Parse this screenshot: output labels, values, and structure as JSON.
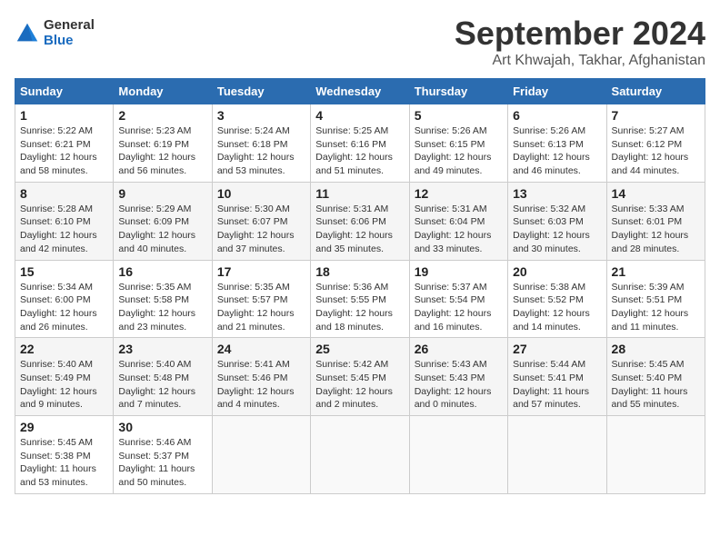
{
  "logo": {
    "general": "General",
    "blue": "Blue"
  },
  "header": {
    "month_title": "September 2024",
    "subtitle": "Art Khwajah, Takhar, Afghanistan"
  },
  "weekdays": [
    "Sunday",
    "Monday",
    "Tuesday",
    "Wednesday",
    "Thursday",
    "Friday",
    "Saturday"
  ],
  "weeks": [
    [
      {
        "day": "1",
        "sunrise": "5:22 AM",
        "sunset": "6:21 PM",
        "hours": "12",
        "minutes": "58"
      },
      {
        "day": "2",
        "sunrise": "5:23 AM",
        "sunset": "6:19 PM",
        "hours": "12",
        "minutes": "56"
      },
      {
        "day": "3",
        "sunrise": "5:24 AM",
        "sunset": "6:18 PM",
        "hours": "12",
        "minutes": "53"
      },
      {
        "day": "4",
        "sunrise": "5:25 AM",
        "sunset": "6:16 PM",
        "hours": "12",
        "minutes": "51"
      },
      {
        "day": "5",
        "sunrise": "5:26 AM",
        "sunset": "6:15 PM",
        "hours": "12",
        "minutes": "49"
      },
      {
        "day": "6",
        "sunrise": "5:26 AM",
        "sunset": "6:13 PM",
        "hours": "12",
        "minutes": "46"
      },
      {
        "day": "7",
        "sunrise": "5:27 AM",
        "sunset": "6:12 PM",
        "hours": "12",
        "minutes": "44"
      }
    ],
    [
      {
        "day": "8",
        "sunrise": "5:28 AM",
        "sunset": "6:10 PM",
        "hours": "12",
        "minutes": "42"
      },
      {
        "day": "9",
        "sunrise": "5:29 AM",
        "sunset": "6:09 PM",
        "hours": "12",
        "minutes": "40"
      },
      {
        "day": "10",
        "sunrise": "5:30 AM",
        "sunset": "6:07 PM",
        "hours": "12",
        "minutes": "37"
      },
      {
        "day": "11",
        "sunrise": "5:31 AM",
        "sunset": "6:06 PM",
        "hours": "12",
        "minutes": "35"
      },
      {
        "day": "12",
        "sunrise": "5:31 AM",
        "sunset": "6:04 PM",
        "hours": "12",
        "minutes": "33"
      },
      {
        "day": "13",
        "sunrise": "5:32 AM",
        "sunset": "6:03 PM",
        "hours": "12",
        "minutes": "30"
      },
      {
        "day": "14",
        "sunrise": "5:33 AM",
        "sunset": "6:01 PM",
        "hours": "12",
        "minutes": "28"
      }
    ],
    [
      {
        "day": "15",
        "sunrise": "5:34 AM",
        "sunset": "6:00 PM",
        "hours": "12",
        "minutes": "26"
      },
      {
        "day": "16",
        "sunrise": "5:35 AM",
        "sunset": "5:58 PM",
        "hours": "12",
        "minutes": "23"
      },
      {
        "day": "17",
        "sunrise": "5:35 AM",
        "sunset": "5:57 PM",
        "hours": "12",
        "minutes": "21"
      },
      {
        "day": "18",
        "sunrise": "5:36 AM",
        "sunset": "5:55 PM",
        "hours": "12",
        "minutes": "18"
      },
      {
        "day": "19",
        "sunrise": "5:37 AM",
        "sunset": "5:54 PM",
        "hours": "12",
        "minutes": "16"
      },
      {
        "day": "20",
        "sunrise": "5:38 AM",
        "sunset": "5:52 PM",
        "hours": "12",
        "minutes": "14"
      },
      {
        "day": "21",
        "sunrise": "5:39 AM",
        "sunset": "5:51 PM",
        "hours": "12",
        "minutes": "11"
      }
    ],
    [
      {
        "day": "22",
        "sunrise": "5:40 AM",
        "sunset": "5:49 PM",
        "hours": "12",
        "minutes": "9"
      },
      {
        "day": "23",
        "sunrise": "5:40 AM",
        "sunset": "5:48 PM",
        "hours": "12",
        "minutes": "7"
      },
      {
        "day": "24",
        "sunrise": "5:41 AM",
        "sunset": "5:46 PM",
        "hours": "12",
        "minutes": "4"
      },
      {
        "day": "25",
        "sunrise": "5:42 AM",
        "sunset": "5:45 PM",
        "hours": "12",
        "minutes": "2"
      },
      {
        "day": "26",
        "sunrise": "5:43 AM",
        "sunset": "5:43 PM",
        "hours": "12",
        "minutes": "0"
      },
      {
        "day": "27",
        "sunrise": "5:44 AM",
        "sunset": "5:41 PM",
        "hours": "11",
        "minutes": "57"
      },
      {
        "day": "28",
        "sunrise": "5:45 AM",
        "sunset": "5:40 PM",
        "hours": "11",
        "minutes": "55"
      }
    ],
    [
      {
        "day": "29",
        "sunrise": "5:45 AM",
        "sunset": "5:38 PM",
        "hours": "11",
        "minutes": "53"
      },
      {
        "day": "30",
        "sunrise": "5:46 AM",
        "sunset": "5:37 PM",
        "hours": "11",
        "minutes": "50"
      },
      null,
      null,
      null,
      null,
      null
    ]
  ],
  "labels": {
    "sunrise": "Sunrise:",
    "sunset": "Sunset:",
    "daylight": "Daylight:",
    "hours_label": "hours",
    "and": "and",
    "minutes_label": "minutes."
  }
}
